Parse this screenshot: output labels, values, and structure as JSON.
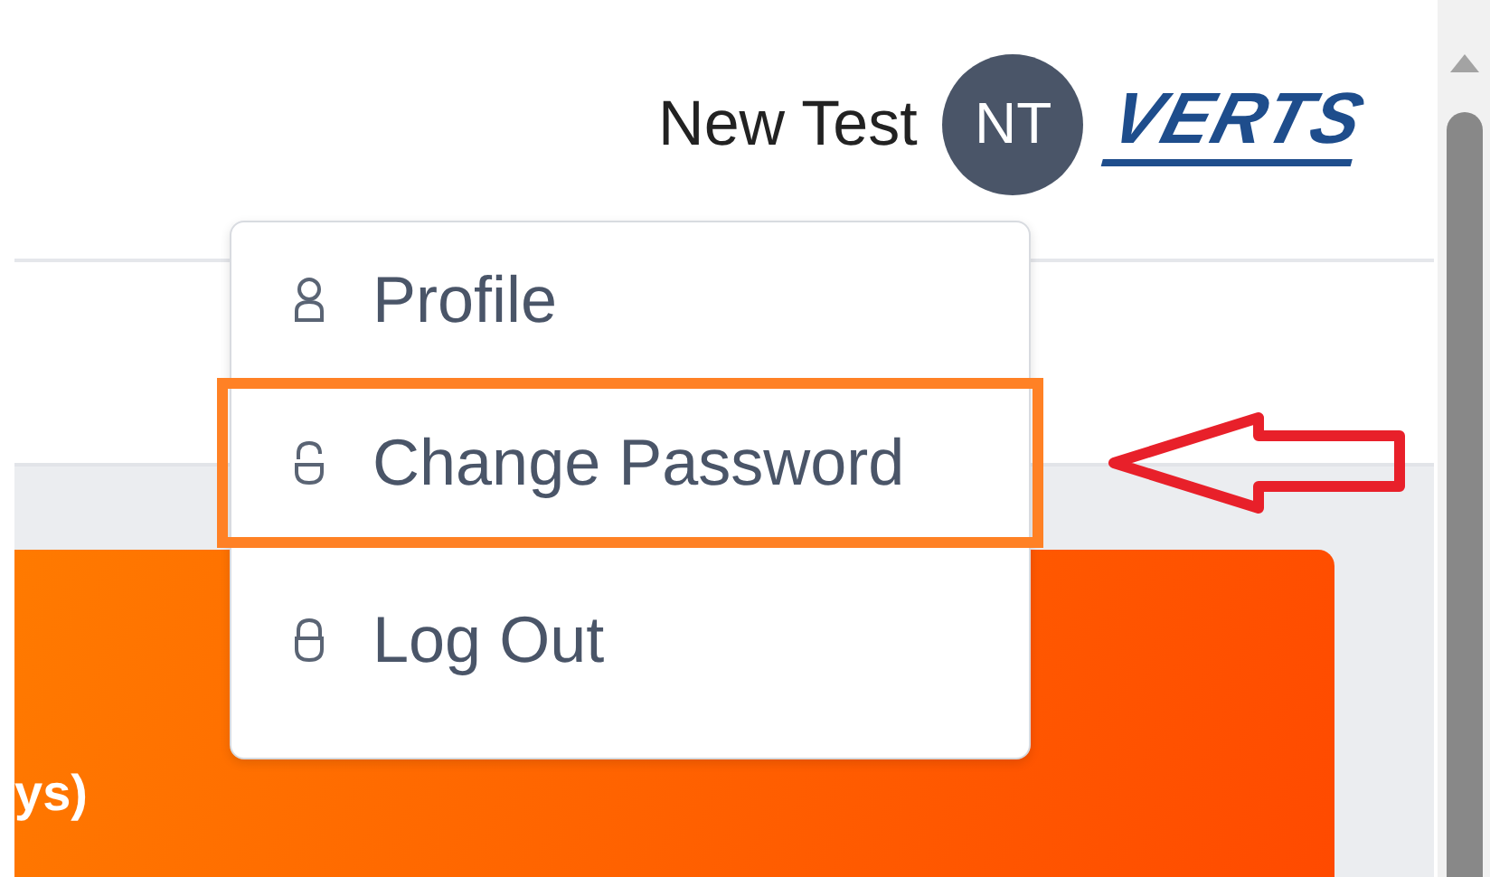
{
  "user": {
    "name": "New Test",
    "initials": "NT"
  },
  "logo": {
    "text": "VERTS"
  },
  "menu": {
    "items": [
      {
        "label": "Profile",
        "kind": "user",
        "highlighted": false
      },
      {
        "label": "Change Password",
        "kind": "unlock",
        "highlighted": true
      },
      {
        "label": "Log Out",
        "kind": "lock",
        "highlighted": false
      }
    ]
  },
  "card": {
    "text": "ys)"
  }
}
